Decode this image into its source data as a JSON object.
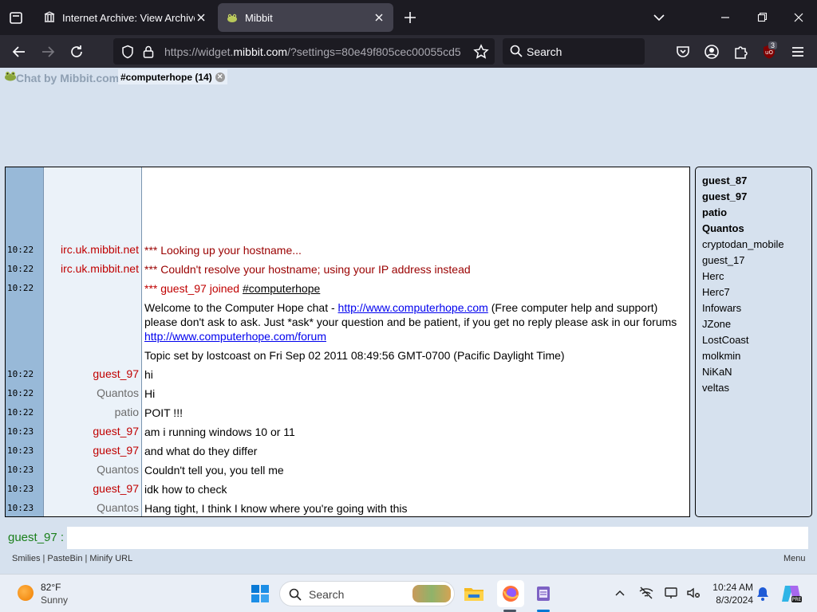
{
  "browser": {
    "tabs": [
      {
        "title": "Internet Archive: View Archive",
        "favicon": "archive-icon",
        "active": false
      },
      {
        "title": "Mibbit",
        "favicon": "mibbit-frog-icon",
        "active": true
      }
    ],
    "url_prefix": "https://widget.",
    "url_domain": "mibbit.com",
    "url_rest": "/?settings=80e49f805cec00055cd5",
    "search_placeholder": "Search",
    "extension_badge": "3"
  },
  "chat": {
    "brand": "Chat by Mibbit.com",
    "channel_tab": "#computerhope (14)",
    "messages": [
      {
        "time": "10:22",
        "nick": "irc.uk.mibbit.net",
        "nick_style": "red",
        "text": "*** Looking up your hostname...",
        "text_style": "sys"
      },
      {
        "time": "10:22",
        "nick": "irc.uk.mibbit.net",
        "nick_style": "red",
        "text": "*** Couldn't resolve your hostname; using your IP address instead",
        "text_style": "sys"
      },
      {
        "time": "10:22",
        "nick": "",
        "nick_style": "",
        "text": "",
        "text_style": "join"
      },
      {
        "time": "",
        "nick": "",
        "nick_style": "",
        "text": "",
        "text_style": "welcome"
      },
      {
        "time": "",
        "nick": "",
        "nick_style": "",
        "text": "Topic set by lostcoast on Fri Sep 02 2011 08:49:56 GMT-0700 (Pacific Daylight Time)",
        "text_style": "plain"
      },
      {
        "time": "10:22",
        "nick": "guest_97",
        "nick_style": "red",
        "text": "hi",
        "text_style": "plain"
      },
      {
        "time": "10:22",
        "nick": "Quantos",
        "nick_style": "grey",
        "text": "Hi",
        "text_style": "plain"
      },
      {
        "time": "10:22",
        "nick": "patio",
        "nick_style": "grey",
        "text": "POIT !!!",
        "text_style": "plain"
      },
      {
        "time": "10:23",
        "nick": "guest_97",
        "nick_style": "red",
        "text": "am i running windows 10 or 11",
        "text_style": "plain"
      },
      {
        "time": "10:23",
        "nick": "guest_97",
        "nick_style": "red",
        "text": "and what do they differ",
        "text_style": "plain"
      },
      {
        "time": "10:23",
        "nick": "Quantos",
        "nick_style": "grey",
        "text": "Couldn't tell you, you tell me",
        "text_style": "plain"
      },
      {
        "time": "10:23",
        "nick": "guest_97",
        "nick_style": "red",
        "text": "idk how to check",
        "text_style": "plain"
      },
      {
        "time": "10:23",
        "nick": "Quantos",
        "nick_style": "grey",
        "text": "Hang tight, I think I know where you're going with this",
        "text_style": "plain"
      }
    ],
    "join": {
      "prefix": "*** guest_97 joined ",
      "channel": "#computerhope"
    },
    "welcome": {
      "part1": "Welcome to the Computer Hope chat - ",
      "link1": "http://www.computerhope.com",
      "part2": " (Free computer help and support) please don't ask to ask. Just *ask* your question and be patient, if you get no reply please ask in our forums ",
      "link2": "http://www.computerhope.com/forum"
    },
    "users_ops": [
      "guest_87",
      "guest_97",
      "patio",
      "Quantos"
    ],
    "users": [
      "cryptodan_mobile",
      "guest_17",
      "Herc",
      "Herc7",
      "Infowars",
      "JZone",
      "LostCoast",
      "molkmin",
      "NiKaN",
      "veltas"
    ],
    "input_nick": "guest_97 :",
    "input_value": "",
    "footer_links": "Smilies | PasteBin | Minify URL",
    "menu_label": "Menu"
  },
  "taskbar": {
    "temperature": "82°F",
    "condition": "Sunny",
    "search_placeholder": "Search",
    "time": "10:24 AM",
    "date": "8/3/2024"
  }
}
